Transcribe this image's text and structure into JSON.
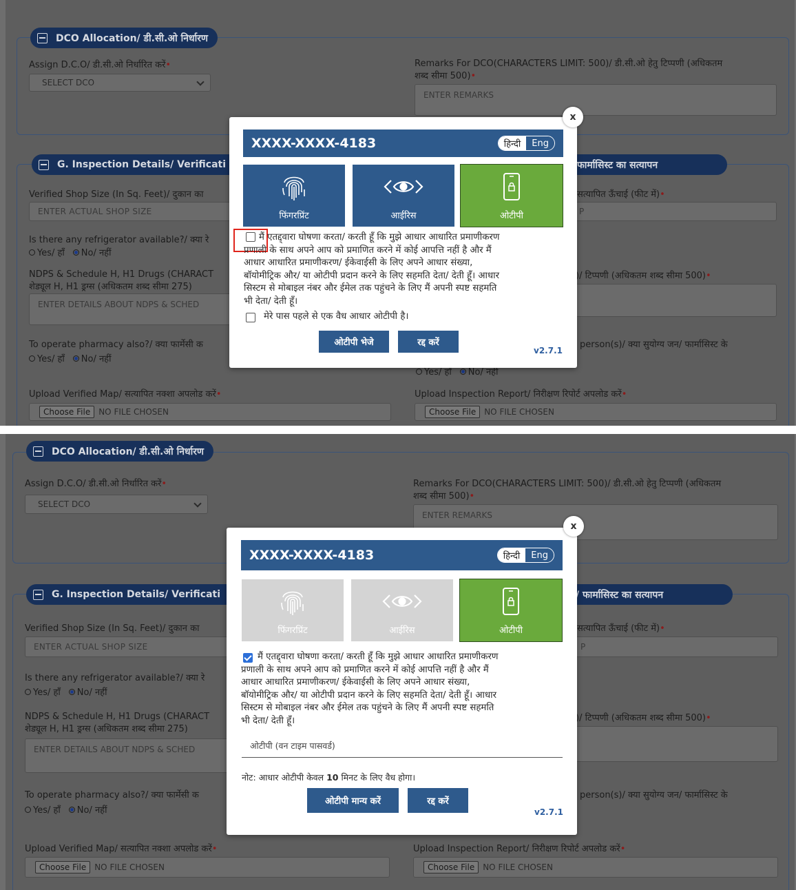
{
  "form": {
    "dco_section_title": "DCO Allocation/ डी.सी.ओ निर्धारण",
    "assign_dco_label": "Assign D.C.O/ डी.सी.ओ निर्धारित करें",
    "select_dco": "SELECT DCO",
    "remarks_label_line1": "Remarks For DCO(CHARACTERS LIMIT: 500)/ डी.सी.ओ हेतु टिप्पणी (अधिकतम",
    "remarks_label_line2": "शब्द सीमा 500)",
    "remarks_placeholder": "ENTER REMARKS",
    "inspection_section_title": "G. Inspection Details/ Verificati",
    "pharmacist_section_fragment": "/ फार्मासिस्ट का सत्यापन",
    "shop_size_label": "Verified Shop Size (In Sq. Feet)/ दुकान का",
    "shop_size_placeholder": "ENTER ACTUAL SHOP SIZE",
    "height_label_fragment": "सत्यापित ऊँचाई (फीट में)",
    "height_placeholder_fragment": "P",
    "refrigerator_label": "Is there any refrigerator available?/ क्या रे",
    "yes": "Yes/ हाँ",
    "no": "No/ नहीं",
    "ndps_label_line1": "NDPS & Schedule H, H1 Drugs (CHARACT",
    "ndps_label_line2": "शेड्यूल H, H1 ड्रग्स (अधिकतम शब्द सीमा 275)",
    "ndps_placeholder": "ENTER DETAILS ABOUT NDPS & SCHED",
    "remark2_label_fragment": ")/ टिप्पणी (अधिकतम शब्द सीमा 500)",
    "pharmacy_label": "To operate pharmacy also?/ क्या फार्मेसी क",
    "person_label_fragment": "person(s)/ क्या सुयोग्य जन/ फार्मासिस्ट के",
    "yes_partial": "Yes/ हाँ",
    "no_partial": "No/ नहीं",
    "upload_map_label": "Upload Verified Map/ सत्यापित नक्शा अपलोड करें",
    "upload_report_label": "Upload Inspection Report/ निरीक्षण रिपोर्ट अपलोड करें",
    "choose_file": "Choose File",
    "no_file": "NO FILE CHOSEN",
    "cut_text_top": "Upload Inspection Report/ निरीक्षण रिपोर्ट अपलोड करें"
  },
  "modal": {
    "close": "x",
    "aadhaar_masked": "XXXX-XXXX-4183",
    "lang_hindi": "हिन्दी",
    "lang_eng": "Eng",
    "tab_fingerprint": "फिंगरप्रिंट",
    "tab_iris": "आईरिस",
    "tab_otp": "ओटीपी",
    "consent_line1": "मैं एतद्द्वारा घोषणा करता/ करती हूँ कि मुझे आधार आधारित प्रमाणीकरण",
    "consent_line2": "प्रणाली के साथ अपने आप को प्रमाणित करने में कोई आपत्ति नहीं है और मैं",
    "consent_line3": "आधार आधारित प्रमाणीकरण/ ईकेवाईसी के लिए अपने आधार संख्या,",
    "consent_line4": "बॉयोमीट्रिक और/ या ओटीपी प्रदान करने के लिए सहमति देता/ देती हूँ। आधार",
    "consent_line5": "सिस्टम से मोबाइल नंबर और ईमेल तक पहुंचने के लिए मैं अपनी स्पष्ट सहमति",
    "consent_line6": "भी देता/ देती हूँ।",
    "have_otp": "मेरे पास पहले से एक वैध आधार ओटीपी है।",
    "send_otp": "ओटीपी भेजे",
    "cancel": "रद्द करें",
    "version": "v2.7.1",
    "otp_placeholder": "ओटीपी (वन टाइम पासवर्ड)",
    "note_prefix": "नोट: आधार ओटीपी केवल ",
    "note_bold": "10",
    "note_suffix": " मिनट के लिए वैध होगा।",
    "verify_otp": "ओटीपी मान्य करें"
  },
  "colors": {
    "header_blue": "#2e5a8c",
    "otp_green": "#6aaa3c",
    "tile_blue": "#2e5a8c",
    "tile_disabled": "#d4d4d4",
    "section_navy": "#17305a",
    "checkbox_checked": "#2c6fd8",
    "highlight_red": "#e0241b"
  },
  "state": {
    "top_consent_checked": false,
    "bottom_consent_checked": true,
    "selected_method": "otp"
  }
}
